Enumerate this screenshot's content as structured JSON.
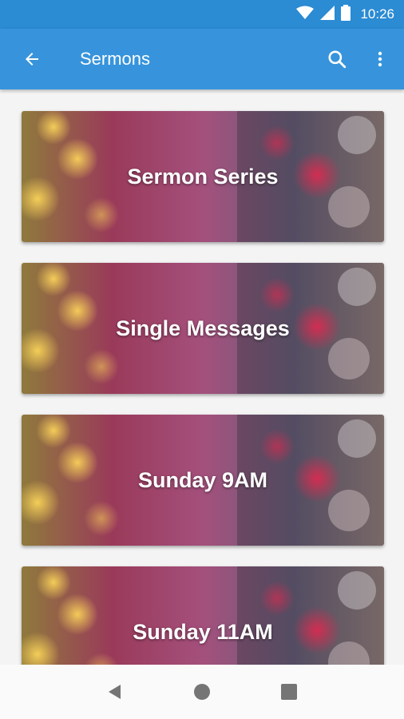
{
  "status_bar": {
    "time": "10:26",
    "icons": [
      "wifi-icon",
      "signal-icon",
      "battery-icon"
    ]
  },
  "app_bar": {
    "title": "Sermons",
    "back_icon": "arrow-back-icon",
    "actions": [
      "search-icon",
      "more-vert-icon"
    ]
  },
  "cards": [
    {
      "label": "Sermon Series"
    },
    {
      "label": "Single Messages"
    },
    {
      "label": "Sunday 9AM"
    },
    {
      "label": "Sunday 11AM"
    }
  ],
  "nav_bar": {
    "buttons": [
      "back-triangle-icon",
      "home-circle-icon",
      "recents-square-icon"
    ]
  },
  "colors": {
    "status_bar": "#2b8bd3",
    "app_bar": "#3794dc",
    "background": "#f4f4f4"
  }
}
